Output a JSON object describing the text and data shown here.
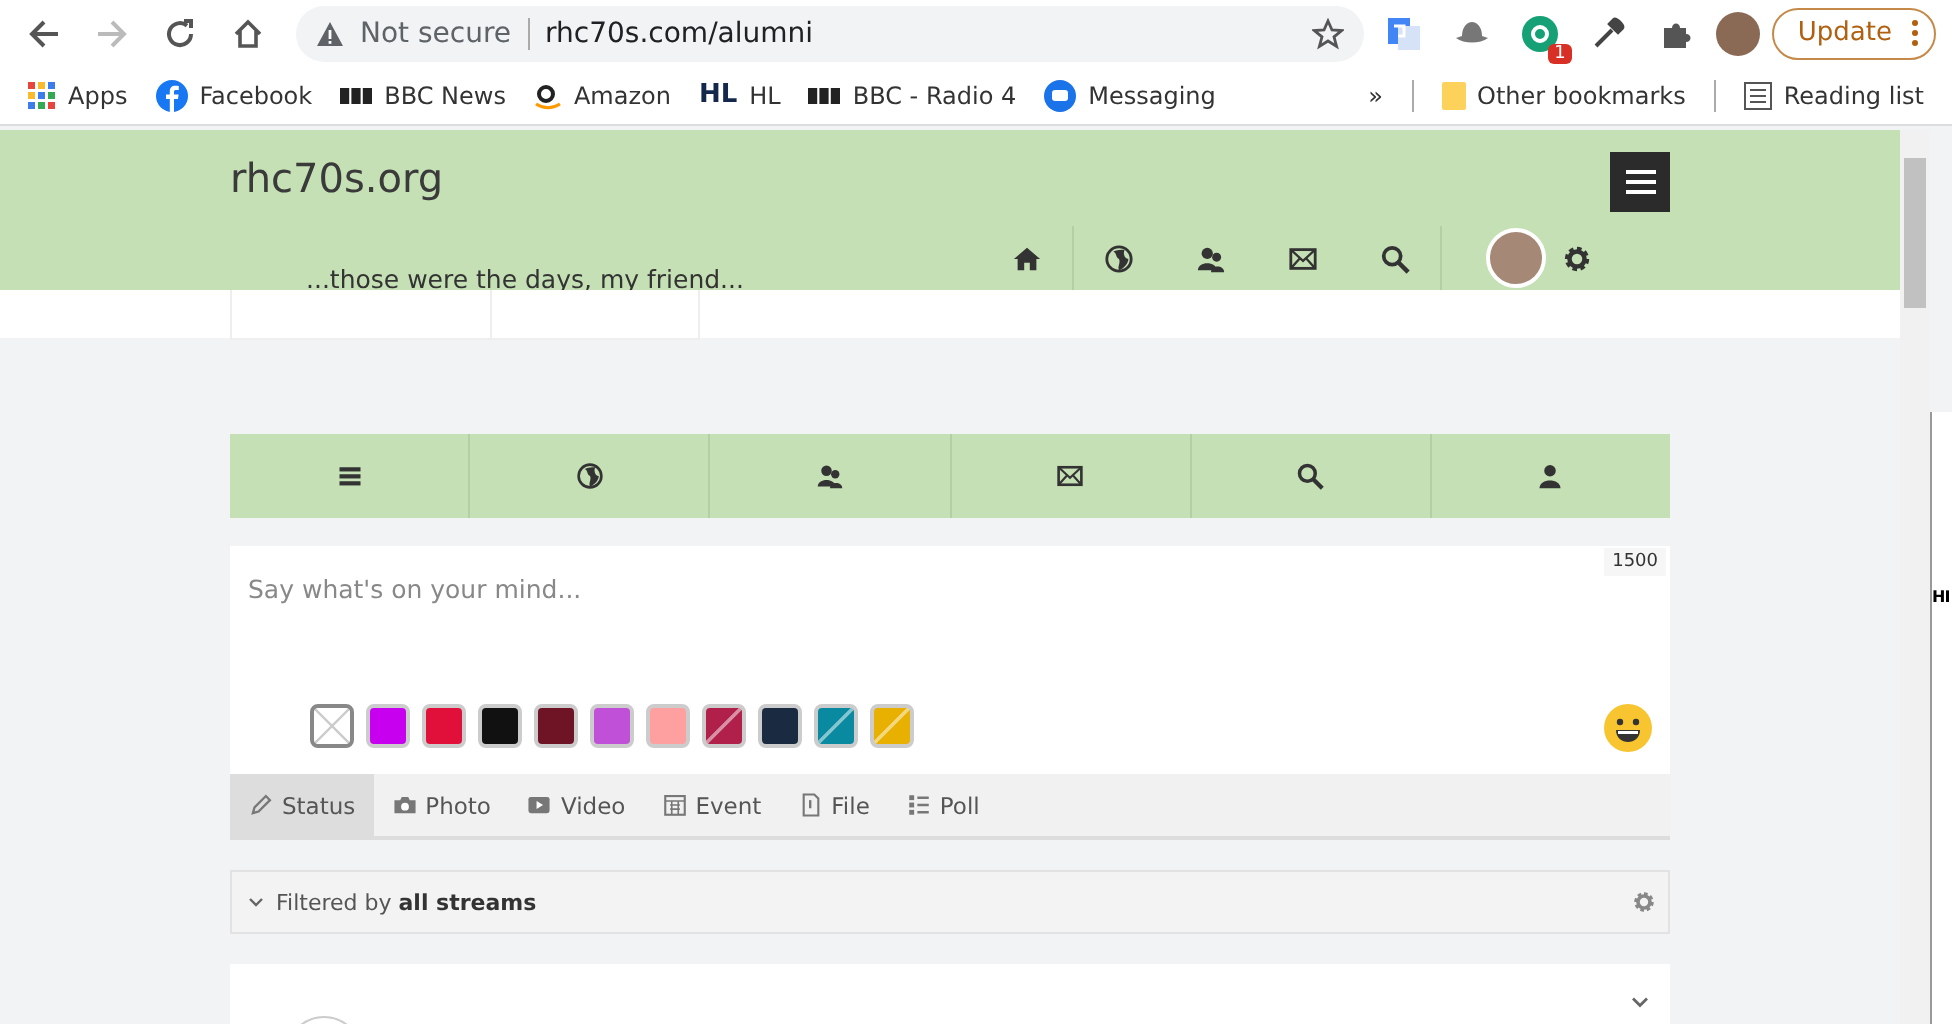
{
  "browser": {
    "security_label": "Not secure",
    "url": "rhc70s.com/alumni",
    "extension_badge": "1",
    "update_button": "Update",
    "bookmarks": [
      {
        "label": "Apps"
      },
      {
        "label": "Facebook"
      },
      {
        "label": "BBC News"
      },
      {
        "label": "Amazon"
      },
      {
        "label": "HL",
        "logo_text": "HL"
      },
      {
        "label": "BBC - Radio 4"
      },
      {
        "label": "Messaging"
      }
    ],
    "overflow": "»",
    "other_bookmarks": "Other bookmarks",
    "reading_list": "Reading list"
  },
  "site": {
    "logo": "rhc70s.org",
    "tagline": "...those were the days, my friend..."
  },
  "composer": {
    "placeholder": "Say what's on your mind...",
    "counter": "1500",
    "backgrounds": [
      {
        "kind": "none",
        "selected": true
      },
      {
        "kind": "solid",
        "color": "#c800f0",
        "selected": false
      },
      {
        "kind": "solid",
        "color": "#e0103a",
        "selected": false
      },
      {
        "kind": "solid",
        "color": "#111111",
        "selected": false
      },
      {
        "kind": "solid",
        "color": "#6e1425",
        "selected": false
      },
      {
        "kind": "solid",
        "color": "#c050d8",
        "selected": false
      },
      {
        "kind": "solid",
        "color": "#ffa0a0",
        "selected": false
      },
      {
        "kind": "pattern",
        "color": "#b0204a",
        "selected": false
      },
      {
        "kind": "solid",
        "color": "#1a2a40",
        "selected": false
      },
      {
        "kind": "pattern",
        "color": "#0a8aa0",
        "selected": false
      },
      {
        "kind": "pattern",
        "color": "#e8b000",
        "selected": false
      }
    ],
    "tabs": [
      {
        "label": "Status",
        "selected": true
      },
      {
        "label": "Photo",
        "selected": false
      },
      {
        "label": "Video",
        "selected": false
      },
      {
        "label": "Event",
        "selected": false
      },
      {
        "label": "File",
        "selected": false
      },
      {
        "label": "Poll",
        "selected": false
      }
    ]
  },
  "filter": {
    "text": "Filtered by **all streams**"
  },
  "background_window": {
    "text": "HI"
  }
}
